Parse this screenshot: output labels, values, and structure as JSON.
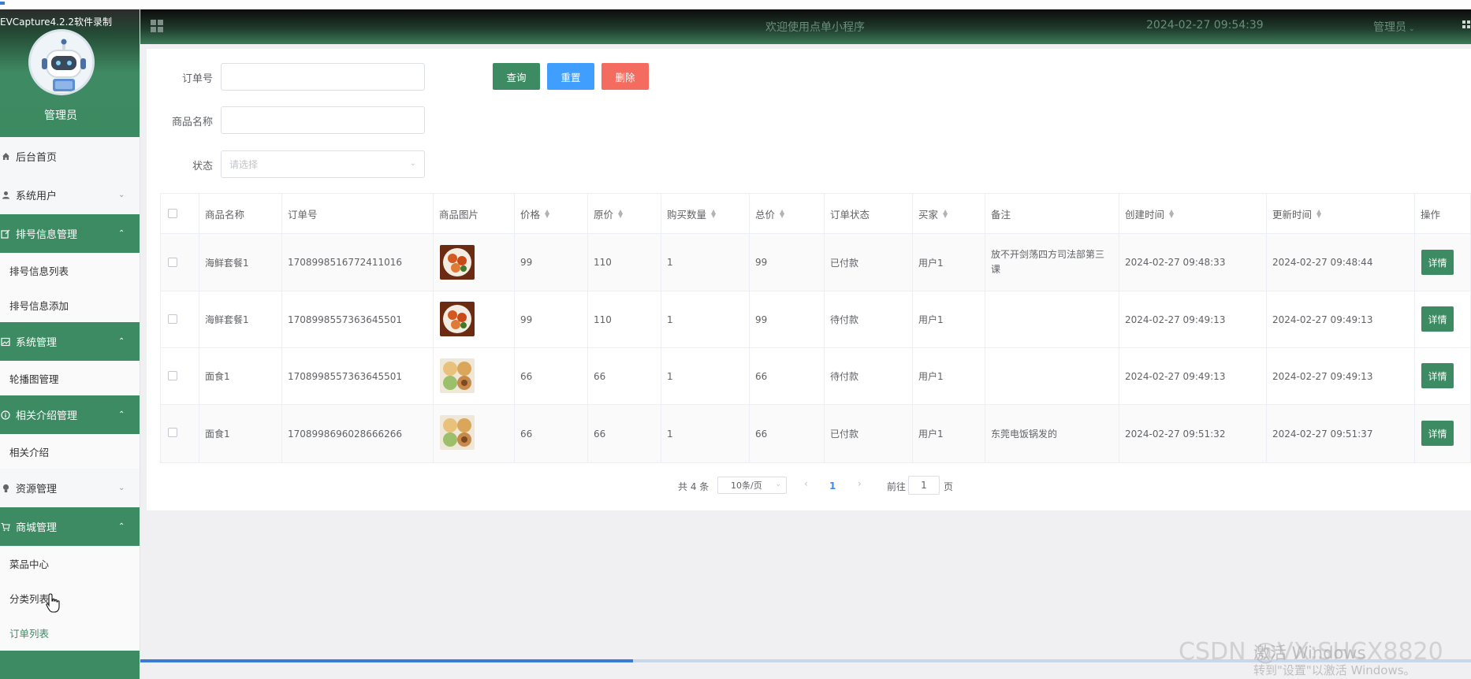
{
  "recorder_label": "EVCapture4.2.2软件录制",
  "sidebar": {
    "role_name": "管理员",
    "items": [
      {
        "name": "menu-home",
        "label": "后台首页",
        "icon": "home-icon",
        "type": "item"
      },
      {
        "name": "menu-system-users",
        "label": "系统用户",
        "icon": "user-icon",
        "type": "collapsed"
      },
      {
        "name": "menu-queue-info",
        "label": "排号信息管理",
        "icon": "edit-icon",
        "type": "open"
      },
      {
        "name": "menu-queue-list",
        "label": "排号信息列表",
        "type": "sub"
      },
      {
        "name": "menu-queue-add",
        "label": "排号信息添加",
        "type": "sub"
      },
      {
        "name": "menu-system-manage",
        "label": "系统管理",
        "icon": "image-icon",
        "type": "open"
      },
      {
        "name": "menu-carousel",
        "label": "轮播图管理",
        "type": "sub"
      },
      {
        "name": "menu-intro-manage",
        "label": "相关介绍管理",
        "icon": "info-icon",
        "type": "open"
      },
      {
        "name": "menu-intro",
        "label": "相关介绍",
        "type": "sub"
      },
      {
        "name": "menu-resources",
        "label": "资源管理",
        "icon": "bulb-icon",
        "type": "collapsed"
      },
      {
        "name": "menu-mall",
        "label": "商城管理",
        "icon": "cart-icon",
        "type": "open"
      },
      {
        "name": "menu-dishes",
        "label": "菜品中心",
        "type": "sub"
      },
      {
        "name": "menu-categories",
        "label": "分类列表",
        "type": "sub"
      },
      {
        "name": "menu-orders",
        "label": "订单列表",
        "type": "sub",
        "active": true
      }
    ]
  },
  "header": {
    "welcome": "欢迎使用点单小程序",
    "datetime": "2024-02-27 09:54:39",
    "user": "管理员"
  },
  "search": {
    "order_no_label": "订单号",
    "order_no_value": "",
    "product_label": "商品名称",
    "product_value": "",
    "status_label": "状态",
    "status_placeholder": "请选择",
    "query_btn": "查询",
    "reset_btn": "重置",
    "delete_btn": "删除"
  },
  "table": {
    "headers": [
      "商品名称",
      "订单号",
      "商品图片",
      "价格",
      "原价",
      "购买数量",
      "总价",
      "订单状态",
      "买家",
      "备注",
      "创建时间",
      "更新时间",
      "操作"
    ],
    "detail_label": "详情",
    "rows": [
      {
        "product": "海鲜套餐1",
        "order_no": "1708998516772411016",
        "price": "99",
        "original_price": "110",
        "qty": "1",
        "total": "99",
        "status": "已付款",
        "buyer": "用户1",
        "note": "放不开剑荡四方司法部第三课",
        "created": "2024-02-27 09:48:33",
        "updated": "2024-02-27 09:48:44",
        "image": "seafood"
      },
      {
        "product": "海鲜套餐1",
        "order_no": "1708998557363645501",
        "price": "99",
        "original_price": "110",
        "qty": "1",
        "total": "99",
        "status": "待付款",
        "buyer": "用户1",
        "note": "",
        "created": "2024-02-27 09:49:13",
        "updated": "2024-02-27 09:49:13",
        "image": "seafood"
      },
      {
        "product": "面食1",
        "order_no": "1708998557363645501",
        "price": "66",
        "original_price": "66",
        "qty": "1",
        "total": "66",
        "status": "待付款",
        "buyer": "用户1",
        "note": "",
        "created": "2024-02-27 09:49:13",
        "updated": "2024-02-27 09:49:13",
        "image": "noodles"
      },
      {
        "product": "面食1",
        "order_no": "1708998696028666266",
        "price": "66",
        "original_price": "66",
        "qty": "1",
        "total": "66",
        "status": "已付款",
        "buyer": "用户1",
        "note": "东莞电饭锅发的",
        "created": "2024-02-27 09:51:32",
        "updated": "2024-02-27 09:51:37",
        "image": "noodles"
      }
    ]
  },
  "pagination": {
    "total": "共 4 条",
    "page_size": "10条/页",
    "prev": "‹",
    "next": "›",
    "current_page": "1",
    "goto_label": "前往",
    "goto_value": "1",
    "page_unit": "页"
  },
  "playback_progress": 0.37,
  "watermark": {
    "activate_title": "激活 Windows",
    "activate_sub": "转到\"设置\"以激活 Windows。",
    "csdn": "CSDN @VX:SHCX8820"
  },
  "colors": {
    "primary_green": "#3d8b62",
    "blue": "#409eff",
    "red": "#f36c5f",
    "page_active": "#3a8ee6"
  }
}
